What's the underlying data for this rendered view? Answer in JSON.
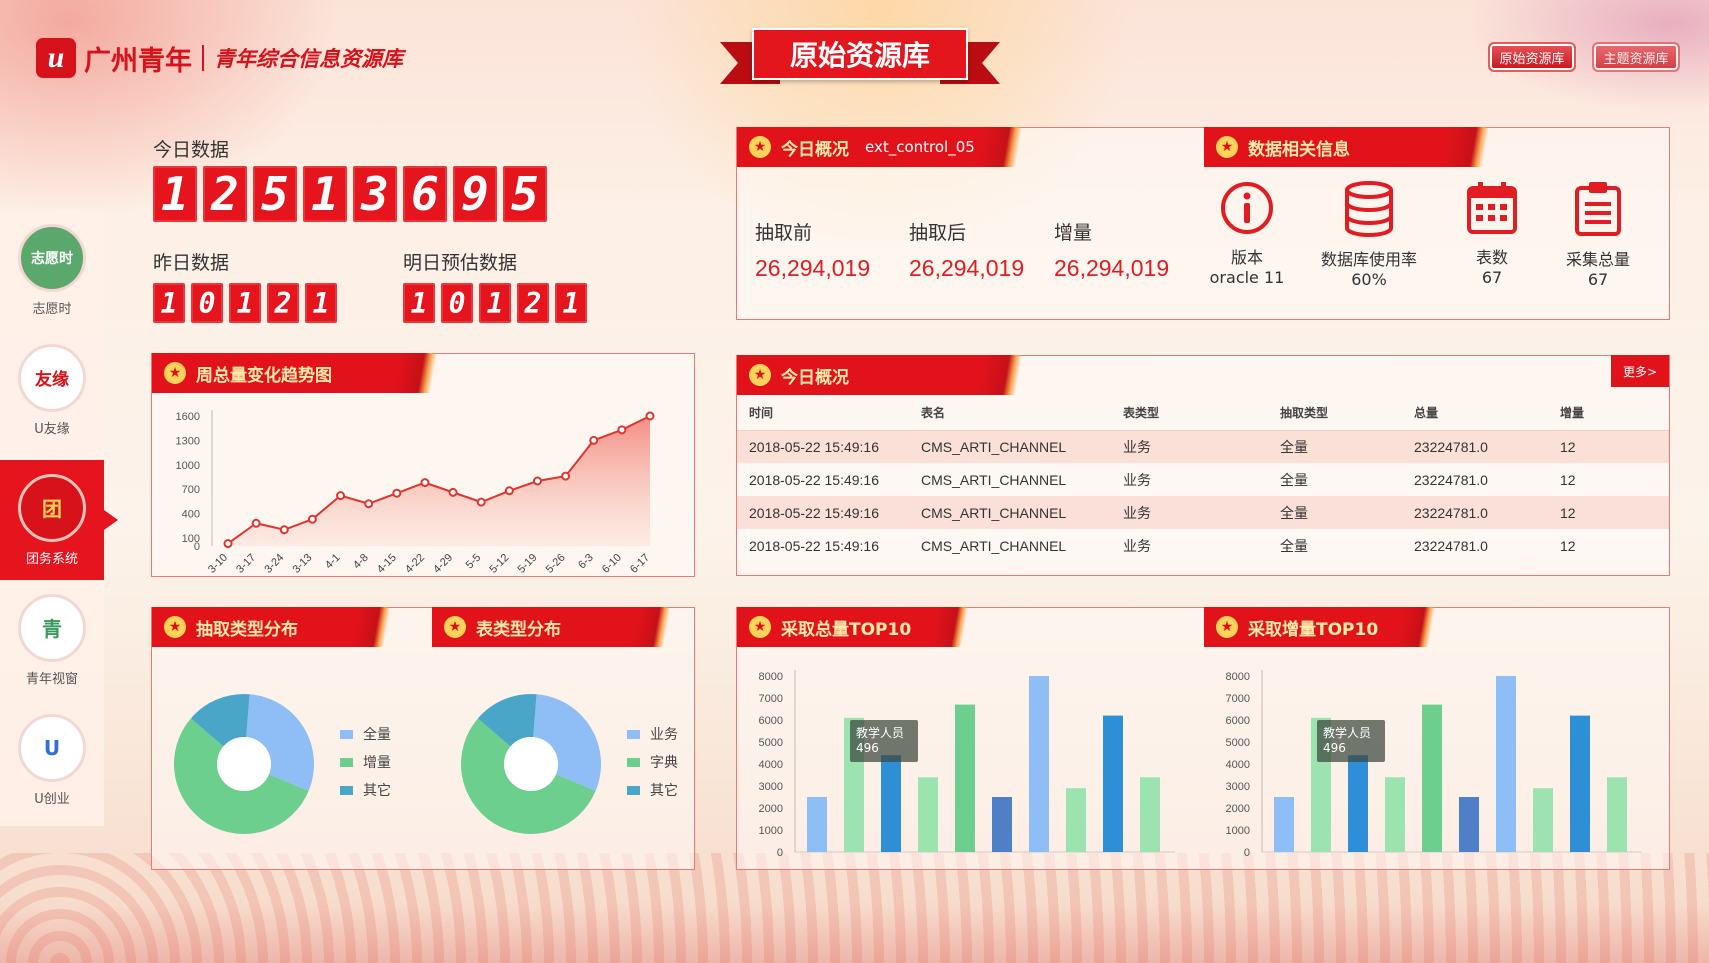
{
  "header": {
    "logo_mark": "u",
    "logo_name": "广州青年",
    "logo_sub": "青年综合信息资源库",
    "banner": "原始资源库",
    "buttons": [
      "原始资源库",
      "主题资源库"
    ]
  },
  "sidebar": {
    "items": [
      {
        "label": "志愿时",
        "icon": "志愿时",
        "active": false
      },
      {
        "label": "U友缘",
        "icon": "友缘",
        "active": false
      },
      {
        "label": "团务系统",
        "icon": "团",
        "active": true
      },
      {
        "label": "青年视窗",
        "icon": "青",
        "active": false
      },
      {
        "label": "U创业",
        "icon": "U",
        "active": false
      }
    ]
  },
  "counters": {
    "today_label": "今日数据",
    "today_digits": [
      "1",
      "2",
      "5",
      "1",
      "3",
      "6",
      "9",
      "5"
    ],
    "yesterday_label": "昨日数据",
    "yesterday_digits": [
      "1",
      "0",
      "1",
      "2",
      "1"
    ],
    "tomorrow_label": "明日预估数据",
    "tomorrow_digits": [
      "1",
      "0",
      "1",
      "2",
      "1"
    ]
  },
  "overview": {
    "title": "今日概况",
    "subtitle": "ext_control_05",
    "stats": [
      {
        "k": "抽取前",
        "v": "26,294,019"
      },
      {
        "k": "抽取后",
        "v": "26,294,019"
      },
      {
        "k": "增量",
        "v": "26,294,019"
      }
    ]
  },
  "datainfo": {
    "title": "数据相关信息",
    "items": [
      {
        "icon": "info-icon",
        "label": "版本",
        "value": "oracle 11"
      },
      {
        "icon": "database-icon",
        "label": "数据库使用率",
        "value": "60%"
      },
      {
        "icon": "calendar-icon",
        "label": "表数",
        "value": "67"
      },
      {
        "icon": "clipboard-icon",
        "label": "采集总量",
        "value": "67"
      }
    ]
  },
  "trend": {
    "title": "周总量变化趋势图"
  },
  "today_table": {
    "title": "今日概况",
    "more": "更多>",
    "headers": [
      "时间",
      "表名",
      "表类型",
      "抽取类型",
      "总量",
      "增量"
    ],
    "rows": [
      [
        "2018-05-22 15:49:16",
        "CMS_ARTI_CHANNEL",
        "业务",
        "全量",
        "23224781.0",
        "12"
      ],
      [
        "2018-05-22 15:49:16",
        "CMS_ARTI_CHANNEL",
        "业务",
        "全量",
        "23224781.0",
        "12"
      ],
      [
        "2018-05-22 15:49:16",
        "CMS_ARTI_CHANNEL",
        "业务",
        "全量",
        "23224781.0",
        "12"
      ],
      [
        "2018-05-22 15:49:16",
        "CMS_ARTI_CHANNEL",
        "业务",
        "全量",
        "23224781.0",
        "12"
      ]
    ]
  },
  "pie1": {
    "title": "抽取类型分布"
  },
  "pie2": {
    "title": "表类型分布"
  },
  "bar1": {
    "title": "采取总量TOP10",
    "tooltip_name": "教学人员",
    "tooltip_value": "496"
  },
  "bar2": {
    "title": "采取增量TOP10",
    "tooltip_name": "教学人员",
    "tooltip_value": "496"
  },
  "colors": {
    "accent": "#e2121b",
    "blue": "#8fbdf5",
    "green": "#6ccf8e",
    "teal": "#4aa6c8",
    "dark_blue": "#2f8fd6"
  },
  "chart_data": [
    {
      "type": "area",
      "title": "",
      "categories": [
        "3-10",
        "3-17",
        "3-24",
        "3-13",
        "4-1",
        "4-8",
        "4-15",
        "4-22",
        "4-29",
        "5-5",
        "5-12",
        "5-19",
        "5-26",
        "6-3",
        "6-10",
        "6-17"
      ],
      "values": [
        30,
        280,
        200,
        330,
        620,
        520,
        650,
        780,
        660,
        540,
        680,
        800,
        860,
        1300,
        1430,
        1600
      ],
      "yticks": [
        0,
        100,
        400,
        700,
        1000,
        1300,
        1600
      ],
      "ylim": [
        0,
        1600
      ]
    },
    {
      "type": "pie",
      "title": "",
      "labels": [
        "全量",
        "增量",
        "其它"
      ],
      "values": [
        30,
        55,
        15
      ],
      "colors": [
        "#8fbdf5",
        "#6ccf8e",
        "#4aa6c8"
      ]
    },
    {
      "type": "pie",
      "title": "",
      "labels": [
        "业务",
        "字典",
        "其它"
      ],
      "values": [
        30,
        55,
        15
      ],
      "colors": [
        "#8fbdf5",
        "#6ccf8e",
        "#4aa6c8"
      ]
    },
    {
      "type": "bar",
      "title": "",
      "values": [
        2500,
        6100,
        4400,
        3400,
        6700,
        2500,
        8000,
        2900,
        6200,
        3400
      ],
      "colors": [
        "#8fbdf5",
        "#9ce3b0",
        "#2f8fd6",
        "#9ce3b0",
        "#6ccf8e",
        "#4f7fc6",
        "#8fbdf5",
        "#9ce3b0",
        "#2f8fd6",
        "#9ce3b0"
      ],
      "yticks": [
        0,
        1000,
        2000,
        3000,
        4000,
        5000,
        6000,
        7000,
        8000
      ],
      "ylim": [
        0,
        8000
      ]
    },
    {
      "type": "bar",
      "title": "",
      "values": [
        2500,
        6100,
        4400,
        3400,
        6700,
        2500,
        8000,
        2900,
        6200,
        3400
      ],
      "colors": [
        "#8fbdf5",
        "#9ce3b0",
        "#2f8fd6",
        "#9ce3b0",
        "#6ccf8e",
        "#4f7fc6",
        "#8fbdf5",
        "#9ce3b0",
        "#2f8fd6",
        "#9ce3b0"
      ],
      "yticks": [
        0,
        1000,
        2000,
        3000,
        4000,
        5000,
        6000,
        7000,
        8000
      ],
      "ylim": [
        0,
        8000
      ]
    }
  ]
}
